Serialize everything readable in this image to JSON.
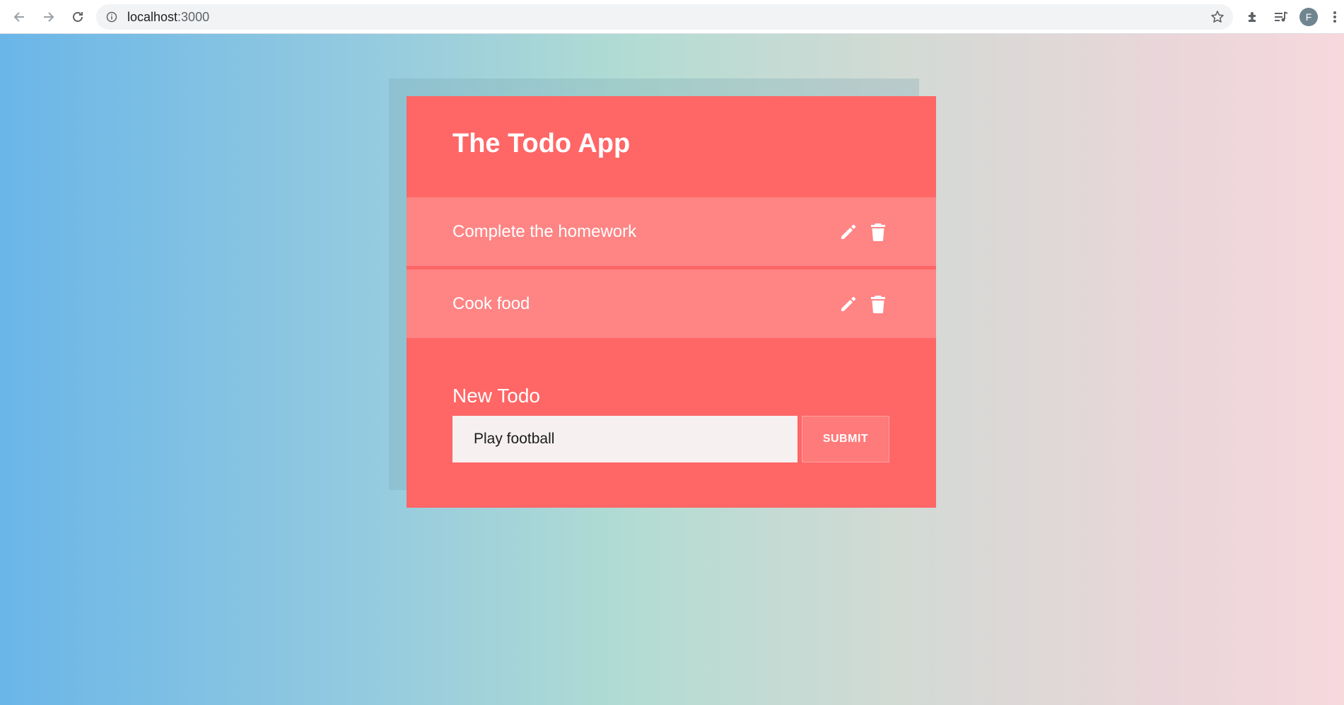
{
  "browser": {
    "url_host": "localhost",
    "url_port": ":3000",
    "profile_initial": "F"
  },
  "app": {
    "title": "The Todo App",
    "todos": [
      {
        "text": "Complete the homework"
      },
      {
        "text": "Cook food"
      }
    ],
    "new_todo": {
      "label": "New Todo",
      "input_value": "Play football",
      "submit_label": "SUBMIT"
    }
  },
  "colors": {
    "card": "#ff6666",
    "todo_item": "#ff8484",
    "input_bg": "#f6f0f0",
    "submit_bg": "#ff7a7a"
  },
  "icons": [
    "back-arrow-icon",
    "forward-arrow-icon",
    "reload-icon",
    "info-icon",
    "star-icon",
    "extensions-icon",
    "media-queue-icon",
    "kebab-menu-icon",
    "pencil-icon",
    "trash-icon"
  ]
}
